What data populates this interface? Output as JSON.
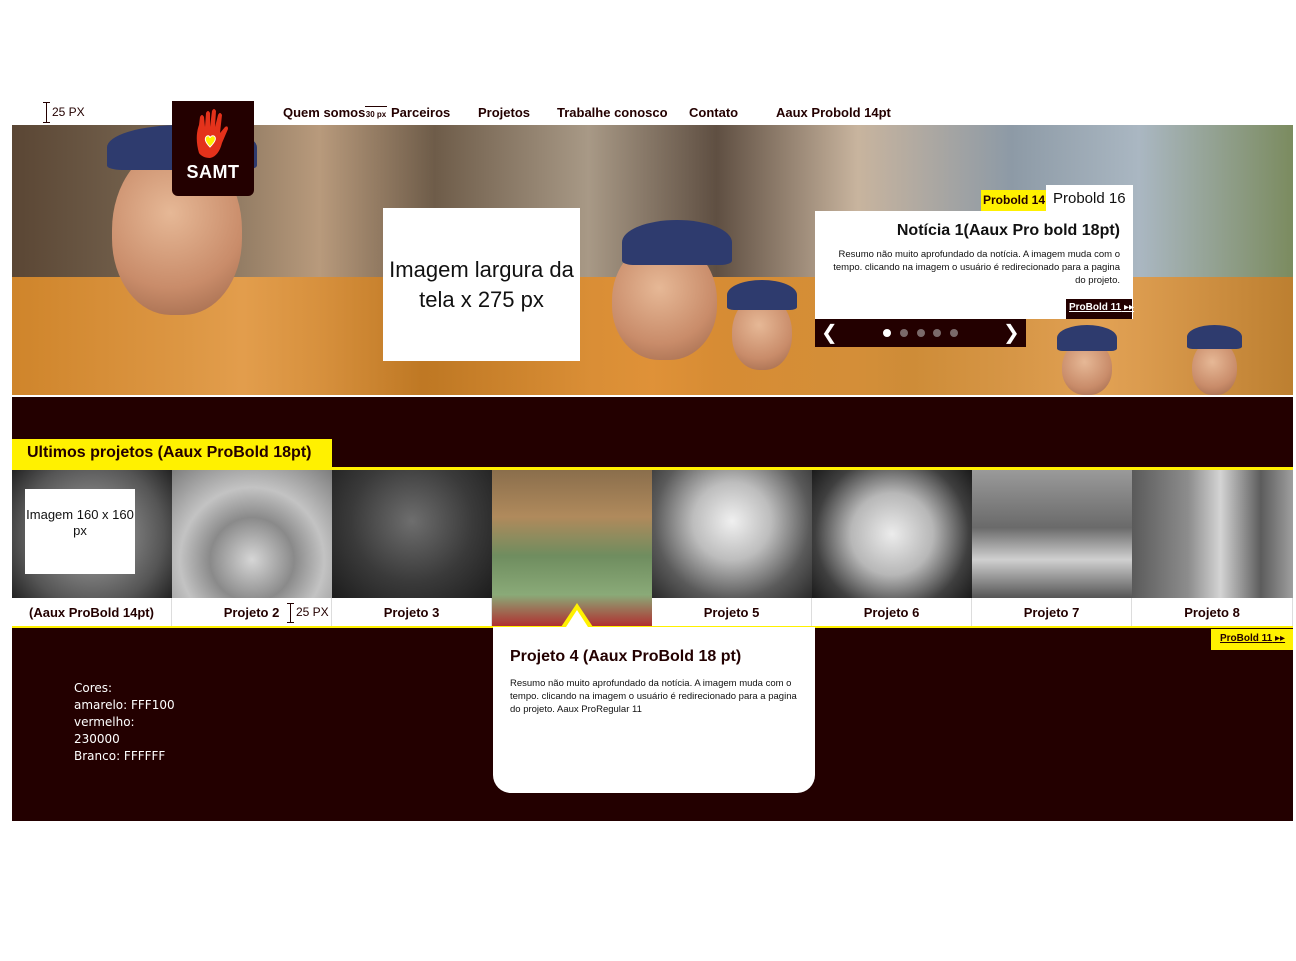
{
  "nav": {
    "dim_label": "25 PX",
    "items": [
      "Quem somos",
      "Parceiros",
      "Projetos",
      "Trabalhe conosco",
      "Contato",
      "Aaux Probold 14pt"
    ],
    "spacing_label": "30 px"
  },
  "logo": {
    "text": "SAMT",
    "icon": "hand-heart-icon"
  },
  "hero": {
    "placeholder": "Imagem largura da tela x 275 px"
  },
  "news": {
    "tab_small": "Probold 14",
    "tab_large": "Probold 16",
    "title": "Notícia 1(Aaux Pro bold 18pt)",
    "body": "Resumo não muito aprofundado da notícia. A imagem muda com o tempo. clicando na imagem o usuário é redirecionado para a pagina do projeto.",
    "more": "ProBold 11",
    "dots": 5,
    "active_dot": 0
  },
  "projects": {
    "section_title": "Ultimos projetos (Aaux ProBold 18pt)",
    "thumb_placeholder": "Imagem 160 x 160 px",
    "labels": [
      "(Aaux ProBold 14pt)",
      "Projeto 2",
      "Projeto 3",
      "",
      "Projeto 5",
      "Projeto 6",
      "Projeto 7",
      "Projeto 8"
    ],
    "dim_label": "25 PX",
    "selected": {
      "title": "Projeto 4 (Aaux ProBold 18 pt)",
      "body": "Resumo não muito aprofundado da notícia. A imagem muda com o tempo. clicando na imagem o usuário é redirecionado para a pagina do projeto. Aaux ProRegular 11"
    },
    "more": "ProBold 11"
  },
  "colors_note": {
    "line1": "Cores:",
    "line2": "amarelo: FFF100",
    "line3": "vermelho:",
    "line4": "230000",
    "line5": "Branco: FFFFFF"
  },
  "palette": {
    "yellow": "#fff100",
    "red": "#230000",
    "white": "#ffffff"
  }
}
